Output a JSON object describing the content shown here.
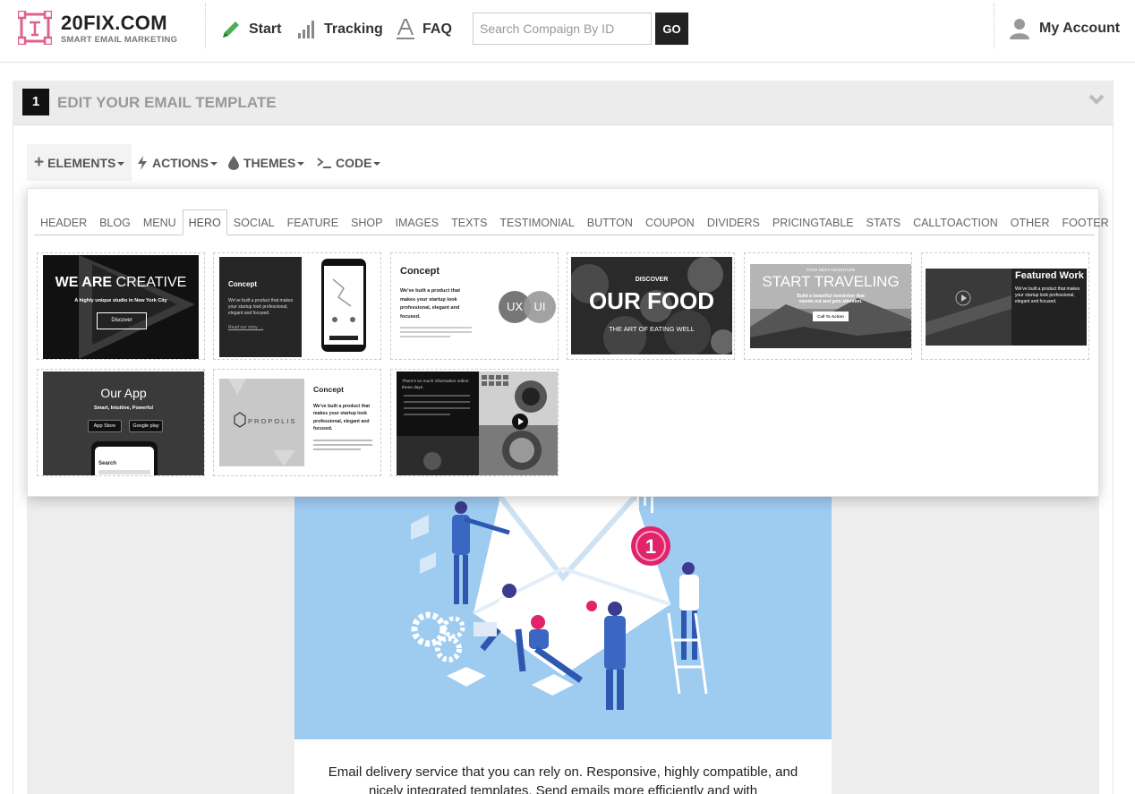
{
  "brand": {
    "name": "20FIX.COM",
    "tagline": "SMART EMAIL MARKETING",
    "accent": "#e0608e"
  },
  "nav": {
    "items": [
      {
        "label": "Start",
        "icon": "pencil-icon"
      },
      {
        "label": "Tracking",
        "icon": "bar-chart-icon"
      },
      {
        "label": "FAQ",
        "icon": "text-icon"
      }
    ],
    "search_placeholder": "Search Compaign By ID",
    "go_label": "GO",
    "account_label": "My Account"
  },
  "step": {
    "number": "1",
    "title": "EDIT YOUR EMAIL TEMPLATE"
  },
  "toolbar": {
    "elements": "ELEMENTS",
    "actions": "ACTIONS",
    "themes": "THEMES",
    "code": "CODE"
  },
  "tabs": [
    "HEADER",
    "BLOG",
    "MENU",
    "HERO",
    "SOCIAL",
    "FEATURE",
    "SHOP",
    "IMAGES",
    "TEXTS",
    "TESTIMONIAL",
    "BUTTON",
    "COUPON",
    "DIVIDERS",
    "PRICINGTABLE",
    "STATS",
    "CALLTOACTION",
    "OTHER",
    "FOOTER"
  ],
  "active_tab": "HERO",
  "thumbnails": {
    "t1": {
      "title_a": "WE ARE",
      "title_b": "CREATIVE",
      "subtitle": "A highly unique studio in New York City",
      "button": "Discover"
    },
    "t2": {
      "title": "Concept",
      "body": "We've built a product that makes your startup look professional, elegant and focused.",
      "link": "Read our story →"
    },
    "t3": {
      "title": "Concept",
      "body": "We've built a product that makes your startup look professional, elegant and focused.",
      "badge_a": "UX",
      "badge_b": "UI"
    },
    "t4": {
      "kicker": "DISCOVER",
      "title": "OUR FOOD",
      "subtitle": "THE ART OF EATING WELL"
    },
    "t5": {
      "kicker": "YOUR NEXT ADVENTURE",
      "title": "START TRAVELING",
      "body": "Build a beautiful newsletter that stands out and gets attention.",
      "button": "Call To Action"
    },
    "t6": {
      "title": "Featured Work",
      "body": "We've built a product that makes your startup look professional, elegant and focused."
    },
    "t7": {
      "title": "Our App",
      "subtitle": "Smart, Intuitive, Powerful",
      "store_a": "App Store",
      "store_b": "Google play",
      "phone_label": "Search"
    },
    "t8": {
      "logo": "PROPOLIS",
      "title": "Concept",
      "body": "We've built a product that makes your startup look professional, elegant and focused."
    },
    "t9": {
      "body": "There's so much information online these days."
    }
  },
  "email": {
    "text": "Email delivery service that you can rely on. Responsive, highly compatible, and nicely integrated templates. Send emails more efficiently and with",
    "notification_count": "1",
    "hero_color": "#9ecbf0"
  }
}
